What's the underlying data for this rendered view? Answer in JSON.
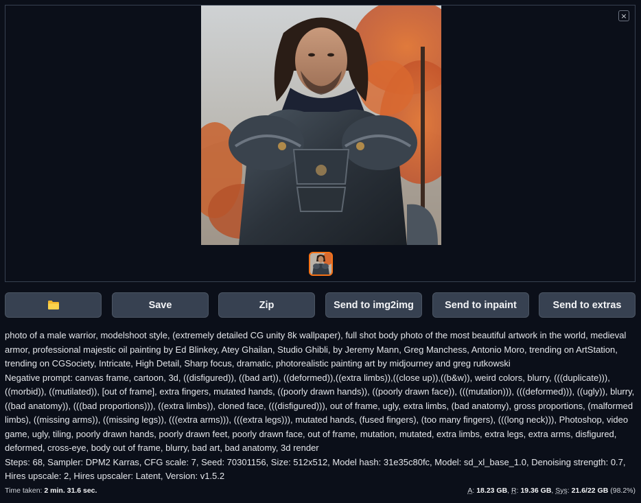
{
  "gallery": {
    "close_label": "×",
    "main_image_alt": "warrior-portrait",
    "thumbnail_count": 1
  },
  "toolbar": {
    "folder_icon": "folder-icon",
    "save_label": "Save",
    "zip_label": "Zip",
    "img2img_label": "Send to img2img",
    "inpaint_label": "Send to inpaint",
    "extras_label": "Send to extras"
  },
  "generation_info": {
    "prompt": "photo of a male warrior, modelshoot style, (extremely detailed CG unity 8k wallpaper), full shot body photo of the most beautiful artwork in the world, medieval armor, professional majestic oil painting by Ed Blinkey, Atey Ghailan, Studio Ghibli, by Jeremy Mann, Greg Manchess, Antonio Moro, trending on ArtStation, trending on CGSociety, Intricate, High Detail, Sharp focus, dramatic, photorealistic painting art by midjourney and greg rutkowski",
    "negative_prompt": "Negative prompt: canvas frame, cartoon, 3d, ((disfigured)), ((bad art)), ((deformed)),((extra limbs)),((close up)),((b&w)), weird colors, blurry, (((duplicate))), ((morbid)), ((mutilated)), [out of frame], extra fingers, mutated hands, ((poorly drawn hands)), ((poorly drawn face)), (((mutation))), (((deformed))), ((ugly)), blurry, ((bad anatomy)), (((bad proportions))), ((extra limbs)), cloned face, (((disfigured))), out of frame, ugly, extra limbs, (bad anatomy), gross proportions, (malformed limbs), ((missing arms)), ((missing legs)), (((extra arms))), (((extra legs))), mutated hands, (fused fingers), (too many fingers), (((long neck))), Photoshop, video game, ugly, tiling, poorly drawn hands, poorly drawn feet, poorly drawn face, out of frame, mutation, mutated, extra limbs, extra legs, extra arms, disfigured, deformed, cross-eye, body out of frame, blurry, bad art, bad anatomy, 3d render",
    "params": "Steps: 68, Sampler: DPM2 Karras, CFG scale: 7, Seed: 70301156, Size: 512x512, Model hash: 31e35c80fc, Model: sd_xl_base_1.0, Denoising strength: 0.7, Hires upscale: 2, Hires upscaler: Latent, Version: v1.5.2"
  },
  "footer": {
    "time_label": "Time taken:",
    "time_value": "2 min. 31.6 sec.",
    "a_label": "A",
    "a_value": "18.23 GB",
    "r_label": "R",
    "r_value": "19.36 GB",
    "sys_label": "Sys",
    "sys_value": "21.6/22 GB",
    "sys_percent": "(98.2%)"
  },
  "colors": {
    "background": "#0b0f19",
    "button": "#374151",
    "thumbnail_border": "#f97316"
  }
}
